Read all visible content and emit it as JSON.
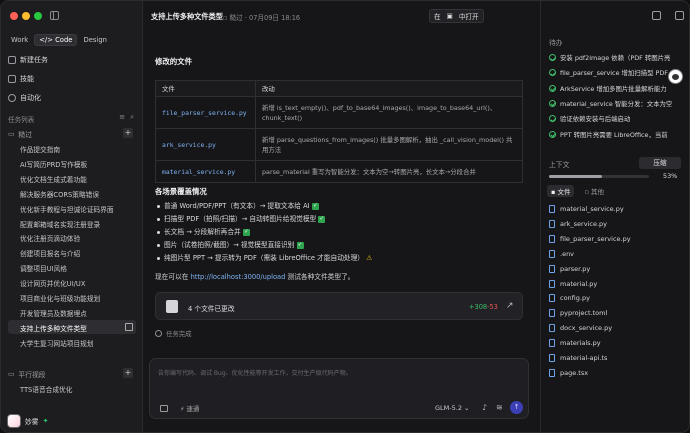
{
  "sidebar": {
    "modes": [
      "Work",
      "Code",
      "Design"
    ],
    "active_mode": "Code",
    "nav": [
      {
        "label": "新建任务",
        "icon": "edit-icon"
      },
      {
        "label": "技能",
        "icon": "cube-icon"
      },
      {
        "label": "自动化",
        "icon": "clock-icon"
      }
    ],
    "tasks_header": "任务列表",
    "group1": "糙过",
    "tasks": [
      "作品提交指南",
      "AI写简历PRD写作模板",
      "优化文档生成式着功能",
      "解决服务器CORS策略错误",
      "优化新手教程与坦诚论证码界面",
      "配置邮箱域名实现注册登录",
      "优化注册页滴动体验",
      "创建项目报名与介绍",
      "调整项目UI风格",
      "设计网页并优化UI/UX",
      "项目商业化与班级功能规划",
      "开发管理员及数据埋点",
      "支持上传多种文件类型",
      "大学生复习网站项目规划"
    ],
    "active_task_index": 12,
    "group2": "平行视段",
    "group2_tasks": [
      "TTS语音合成优化"
    ],
    "user_name": "妙雾"
  },
  "main": {
    "title": "支持上传多种文件类型",
    "meta": "糙过 · 07月09日 18:16",
    "open_in_prefix": "在",
    "open_in_label": "中打开",
    "modified_files_heading": "修改的文件",
    "table_headers": [
      "文件",
      "改动"
    ],
    "table_rows": [
      {
        "file": "file_parser_service.py",
        "change": "新增 is_text_empty()、pdf_to_base64_images()、image_to_base64_url()、chunk_text()"
      },
      {
        "file": "ark_service.py",
        "change": "新增 parse_questions_from_images() 批量多图解析，抽出 _call_vision_model() 共用方法"
      },
      {
        "file": "material_service.py",
        "change": "parse_material 重写为智能分发：文本为空→转图片亮，长文本→分段合并"
      }
    ],
    "scenarios_heading": "各场景覆盖情况",
    "scenarios": [
      {
        "text": "普通 Word/PDF/PPT（有文本）→ 提取文本给 AI",
        "mark": "ok"
      },
      {
        "text": "扫描型 PDF（拍照/扫描）→ 自动转图片给视觉模型",
        "mark": "ok"
      },
      {
        "text": "长文档 → 分段解析再合并",
        "mark": "ok"
      },
      {
        "text": "图片（试卷拍照/截图）→ 视觉模型直接识别",
        "mark": "ok"
      },
      {
        "text": "纯图片型 PPT → 提示转为 PDF（需装 LibreOffice 才能自动处理）",
        "mark": "warn"
      }
    ],
    "conclusion_prefix": "现在可以在",
    "conclusion_link": "http://localhost:3000/upload",
    "conclusion_suffix": "测试各种文件类型了。",
    "changes_label": "4 个文件已更改",
    "changes_added": "+308",
    "changes_removed": "-53",
    "task_done": "任务完成",
    "composer_placeholder": "告你编写代码、调试 Bug、优化性能等开发工作，交付生产级代码产物。",
    "composer_speed": "速通",
    "composer_model": "GLM-5.2"
  },
  "right": {
    "todo_heading": "待办",
    "todos": [
      "安装 pdf2image 依赖（PDF 转图片亮",
      "file_parser_service 增加扫描型 PDF",
      "ArkService 增加多图片批量解析能力",
      "material_service 智能分发：文本为空",
      "验证依赖安装与后端启动",
      "PPT 转图片亮需要 LibreOffice，当前"
    ],
    "context_heading": "上下文",
    "compress_label": "压缩",
    "context_percent": "53%",
    "context_value": 0.53,
    "file_tabs": [
      "文件",
      "其他"
    ],
    "files": [
      "material_service.py",
      "ark_service.py",
      "file_parser_service.py",
      ".env",
      "parser.py",
      "material.py",
      "config.py",
      "pyproject.toml",
      "docx_service.py",
      "materials.py",
      "material-api.ts",
      "page.tsx"
    ]
  }
}
